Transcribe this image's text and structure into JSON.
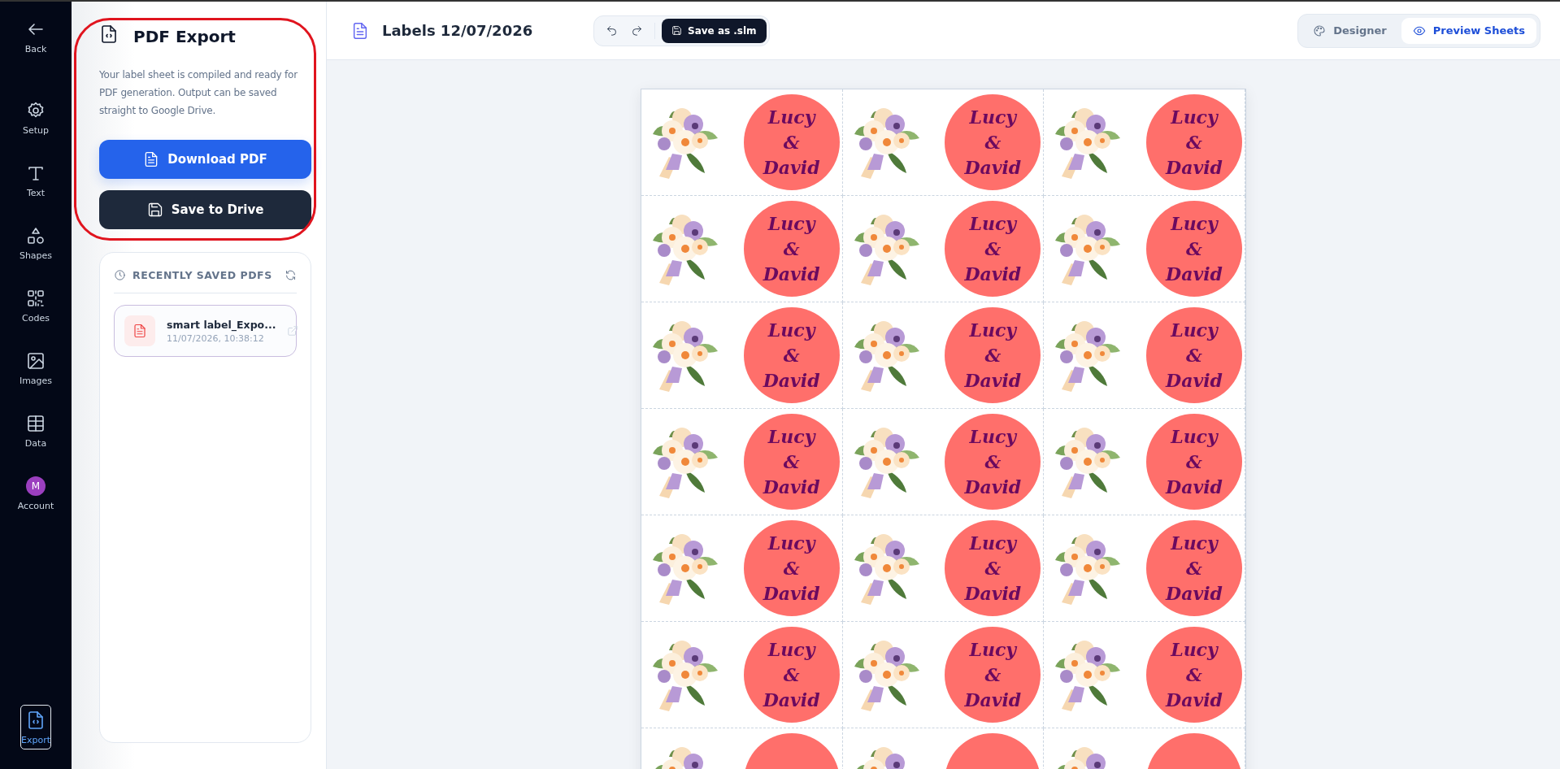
{
  "sidebar": {
    "items": [
      {
        "kind": "back",
        "label": "Back",
        "selected": false
      },
      {
        "kind": "setup",
        "label": "Setup",
        "selected": false
      },
      {
        "kind": "text",
        "label": "Text",
        "selected": false
      },
      {
        "kind": "shapes",
        "label": "Shapes",
        "selected": false
      },
      {
        "kind": "codes",
        "label": "Codes",
        "selected": false
      },
      {
        "kind": "images",
        "label": "Images",
        "selected": false
      },
      {
        "kind": "data",
        "label": "Data",
        "selected": false
      },
      {
        "kind": "account",
        "label": "Account",
        "avatar": "M",
        "selected": false
      }
    ],
    "bottom_item": {
      "kind": "export",
      "label": "Export",
      "selected": true
    }
  },
  "panel": {
    "title": "PDF Export",
    "description": "Your label sheet is compiled and ready for PDF generation. Output can be saved straight to Google Drive.",
    "buttons": [
      {
        "kind": "primary",
        "label": "Download PDF"
      },
      {
        "kind": "dark",
        "label": "Save to Drive"
      }
    ],
    "recent": {
      "heading": "RECENTLY SAVED PDFS",
      "files": [
        {
          "name": "smart label_Expo...",
          "date": "11/07/2026, 10:38:12"
        }
      ]
    }
  },
  "header": {
    "title": "Labels 12/07/2026",
    "save_button": "Save as .slm",
    "tabs": [
      {
        "kind": "designer",
        "label": "Designer",
        "selected": false
      },
      {
        "kind": "preview",
        "label": "Preview Sheets",
        "selected": true
      }
    ]
  },
  "sheet": {
    "labels": [
      {
        "text": "Lucy\n&\nDavid"
      },
      {
        "text": "Lucy\n&\nDavid"
      },
      {
        "text": "Lucy\n&\nDavid"
      },
      {
        "text": "Lucy\n&\nDavid"
      },
      {
        "text": "Lucy\n&\nDavid"
      },
      {
        "text": "Lucy\n&\nDavid"
      },
      {
        "text": "Lucy\n&\nDavid"
      },
      {
        "text": "Lucy\n&\nDavid"
      },
      {
        "text": "Lucy\n&\nDavid"
      },
      {
        "text": "Lucy\n&\nDavid"
      },
      {
        "text": "Lucy\n&\nDavid"
      },
      {
        "text": "Lucy\n&\nDavid"
      },
      {
        "text": "Lucy\n&\nDavid"
      },
      {
        "text": "Lucy\n&\nDavid"
      },
      {
        "text": "Lucy\n&\nDavid"
      },
      {
        "text": "Lucy\n&\nDavid"
      },
      {
        "text": "Lucy\n&\nDavid"
      },
      {
        "text": "Lucy\n&\nDavid"
      }
    ]
  }
}
